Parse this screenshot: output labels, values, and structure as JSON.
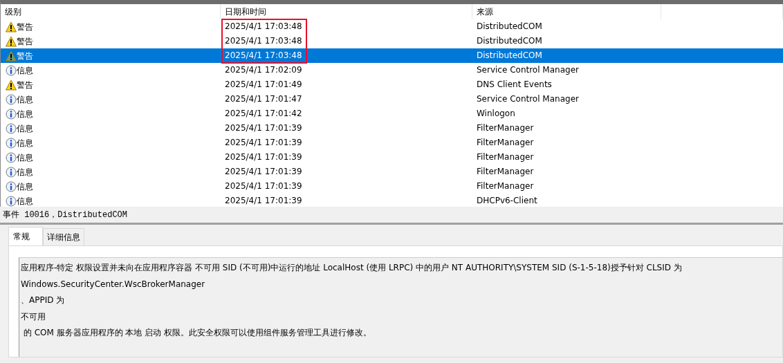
{
  "event_list": {
    "columns": [
      "级别",
      "日期和时间",
      "来源"
    ],
    "rows": [
      {
        "kind": "warning",
        "level_label": "警告",
        "datetime": "2025/4/1 17:03:48",
        "source": "DistributedCOM",
        "selected": false,
        "marked": true
      },
      {
        "kind": "warning",
        "level_label": "警告",
        "datetime": "2025/4/1 17:03:48",
        "source": "DistributedCOM",
        "selected": false,
        "marked": true
      },
      {
        "kind": "warning",
        "level_label": "警告",
        "datetime": "2025/4/1 17:03:48",
        "source": "DistributedCOM",
        "selected": true,
        "marked": true
      },
      {
        "kind": "info",
        "level_label": "信息",
        "datetime": "2025/4/1 17:02:09",
        "source": "Service Control Manager",
        "selected": false,
        "marked": false
      },
      {
        "kind": "warning",
        "level_label": "警告",
        "datetime": "2025/4/1 17:01:49",
        "source": "DNS Client Events",
        "selected": false,
        "marked": false
      },
      {
        "kind": "info",
        "level_label": "信息",
        "datetime": "2025/4/1 17:01:47",
        "source": "Service Control Manager",
        "selected": false,
        "marked": false
      },
      {
        "kind": "info",
        "level_label": "信息",
        "datetime": "2025/4/1 17:01:42",
        "source": "Winlogon",
        "selected": false,
        "marked": false
      },
      {
        "kind": "info",
        "level_label": "信息",
        "datetime": "2025/4/1 17:01:39",
        "source": "FilterManager",
        "selected": false,
        "marked": false
      },
      {
        "kind": "info",
        "level_label": "信息",
        "datetime": "2025/4/1 17:01:39",
        "source": "FilterManager",
        "selected": false,
        "marked": false
      },
      {
        "kind": "info",
        "level_label": "信息",
        "datetime": "2025/4/1 17:01:39",
        "source": "FilterManager",
        "selected": false,
        "marked": false
      },
      {
        "kind": "info",
        "level_label": "信息",
        "datetime": "2025/4/1 17:01:39",
        "source": "FilterManager",
        "selected": false,
        "marked": false
      },
      {
        "kind": "info",
        "level_label": "信息",
        "datetime": "2025/4/1 17:01:39",
        "source": "FilterManager",
        "selected": false,
        "marked": false
      },
      {
        "kind": "info",
        "level_label": "信息",
        "datetime": "2025/4/1 17:01:39",
        "source": "DHCPv6-Client",
        "selected": false,
        "marked": false
      }
    ]
  },
  "event_detail": {
    "title": "事件 10016，DistributedCOM",
    "tabs": [
      {
        "label": "常规",
        "selected": true
      },
      {
        "label": "详细信息",
        "selected": false
      }
    ],
    "description_lines": [
      "应用程序-特定 权限设置并未向在应用程序容器 不可用 SID (不可用)中运行的地址 LocalHost (使用 LRPC) 中的用户 NT AUTHORITY\\SYSTEM SID (S-1-5-18)授予针对 CLSID 为",
      "Windows.SecurityCenter.WscBrokerManager",
      "、APPID 为",
      "不可用",
      " 的 COM 服务器应用程序的 本地 启动 权限。此安全权限可以使用组件服务管理工具进行修改。"
    ]
  }
}
